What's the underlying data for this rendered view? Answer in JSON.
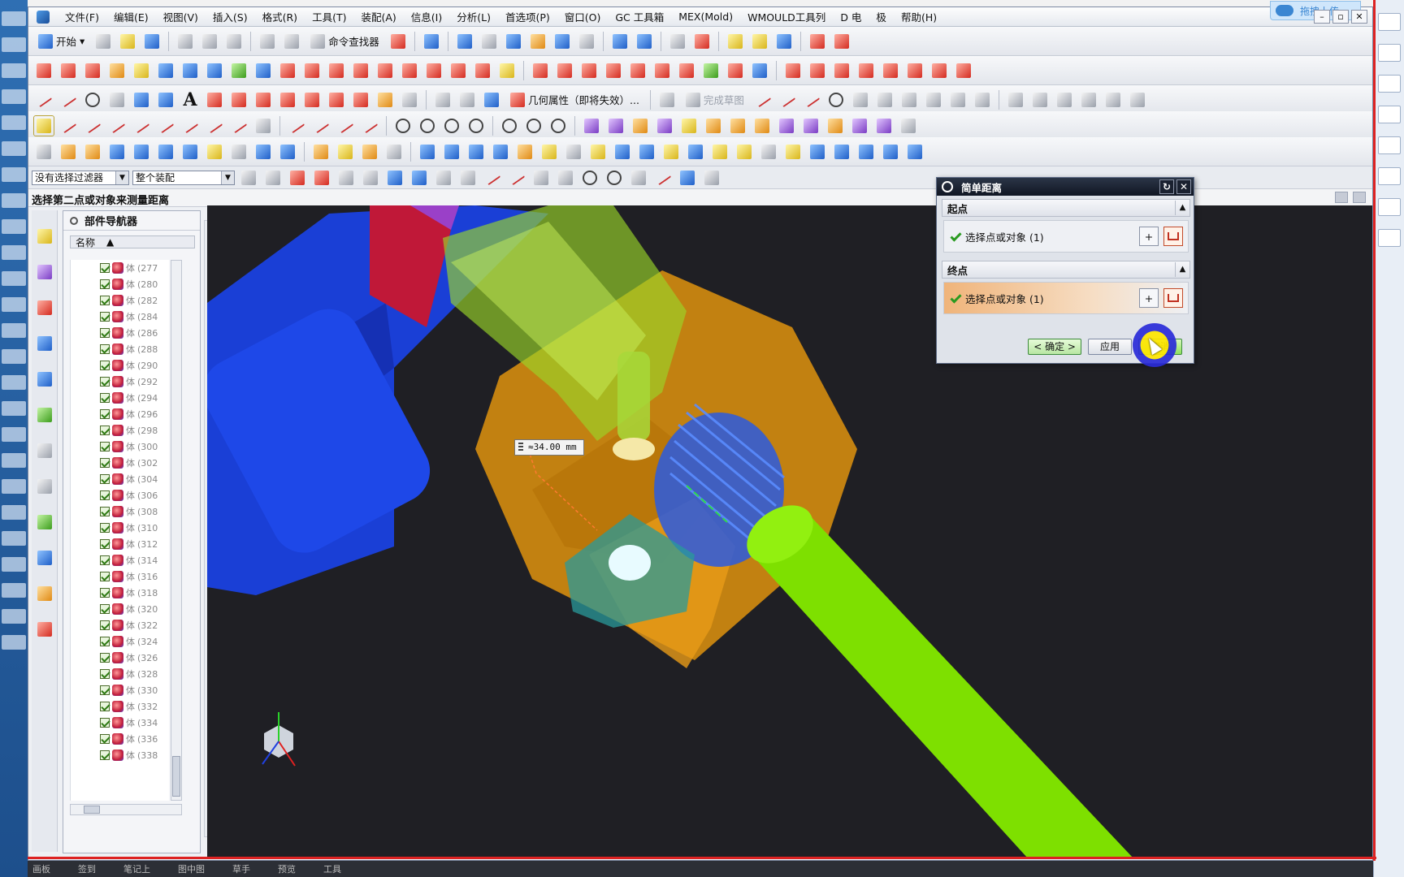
{
  "menu": [
    "文件(F)",
    "编辑(E)",
    "视图(V)",
    "插入(S)",
    "格式(R)",
    "工具(T)",
    "装配(A)",
    "信息(I)",
    "分析(L)",
    "首选项(P)",
    "窗口(O)",
    "GC 工具箱",
    "MEX(Mold)",
    "WMOULD工具列",
    "D 电",
    "极",
    "帮助(H)"
  ],
  "upload_badge": "拖拽上传",
  "toolbar": {
    "start_label": "开始",
    "command_finder_label": "命令查找器",
    "geometry_props_label": "几何属性（即将失效）...",
    "finish_sketch_label": "完成草图"
  },
  "filterbar": {
    "selection_filter": "没有选择过滤器",
    "assembly_scope": "整个装配"
  },
  "cue_line": "选择第二点或对象来测量距离",
  "part_navigator": {
    "title": "部件导航器",
    "column_name": "名称",
    "rows": [
      {
        "label": "体",
        "id": "(277"
      },
      {
        "label": "体",
        "id": "(280"
      },
      {
        "label": "体",
        "id": "(282"
      },
      {
        "label": "体",
        "id": "(284"
      },
      {
        "label": "体",
        "id": "(286"
      },
      {
        "label": "体",
        "id": "(288"
      },
      {
        "label": "体",
        "id": "(290"
      },
      {
        "label": "体",
        "id": "(292"
      },
      {
        "label": "体",
        "id": "(294"
      },
      {
        "label": "体",
        "id": "(296"
      },
      {
        "label": "体",
        "id": "(298"
      },
      {
        "label": "体",
        "id": "(300"
      },
      {
        "label": "体",
        "id": "(302"
      },
      {
        "label": "体",
        "id": "(304"
      },
      {
        "label": "体",
        "id": "(306"
      },
      {
        "label": "体",
        "id": "(308"
      },
      {
        "label": "体",
        "id": "(310"
      },
      {
        "label": "体",
        "id": "(312"
      },
      {
        "label": "体",
        "id": "(314"
      },
      {
        "label": "体",
        "id": "(316"
      },
      {
        "label": "体",
        "id": "(318"
      },
      {
        "label": "体",
        "id": "(320"
      },
      {
        "label": "体",
        "id": "(322"
      },
      {
        "label": "体",
        "id": "(324"
      },
      {
        "label": "体",
        "id": "(326"
      },
      {
        "label": "体",
        "id": "(328"
      },
      {
        "label": "体",
        "id": "(330"
      },
      {
        "label": "体",
        "id": "(332"
      },
      {
        "label": "体",
        "id": "(334"
      },
      {
        "label": "体",
        "id": "(336"
      },
      {
        "label": "体",
        "id": "(338"
      }
    ]
  },
  "viewport": {
    "measurement": "≈34.00 mm"
  },
  "dialog": {
    "title": "简单距离",
    "start_section": "起点",
    "start_selection": "选择点或对象 (1)",
    "end_section": "终点",
    "end_selection": "选择点或对象 (1)",
    "ok_label": "< 确定 >",
    "apply_label": "应用",
    "cancel_label": "取消"
  },
  "taskbar": [
    "画板",
    "签到",
    "笔记上",
    "图中图",
    "草手",
    "预览",
    "工具"
  ]
}
